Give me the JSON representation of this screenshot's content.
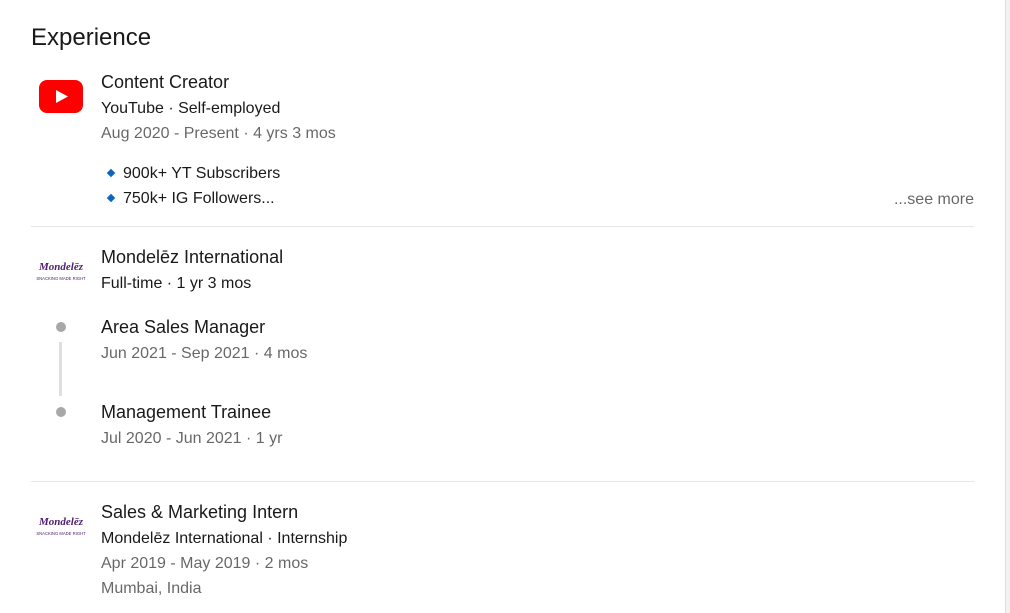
{
  "section": {
    "title": "Experience"
  },
  "accent": "#0a66c2",
  "items": [
    {
      "logo_icon": "youtube-logo-icon",
      "title": "Content Creator",
      "subtitle": "YouTube · Self-employed",
      "dates": "Aug 2020 - Present · 4 yrs 3 mos",
      "bullets": [
        "900k+ YT Subscribers",
        "750k+ IG Followers..."
      ],
      "see_more": "...see more"
    },
    {
      "logo_icon": "mondelez-logo-icon",
      "logo_text": "Mondelēz",
      "logo_tagline": "SNACKING MADE RIGHT",
      "title": "Mondelēz International",
      "subtitle": "Full-time · 1 yr 3 mos",
      "roles": [
        {
          "title": "Area Sales Manager",
          "dates": "Jun 2021 - Sep 2021 · 4 mos"
        },
        {
          "title": "Management Trainee",
          "dates": "Jul 2020 - Jun 2021 · 1 yr"
        }
      ]
    },
    {
      "logo_icon": "mondelez-logo-icon",
      "logo_text": "Mondelēz",
      "logo_tagline": "SNACKING MADE RIGHT",
      "title": "Sales & Marketing Intern",
      "subtitle": "Mondelēz International · Internship",
      "dates": "Apr 2019 - May 2019 · 2 mos",
      "location": "Mumbai, India"
    }
  ]
}
